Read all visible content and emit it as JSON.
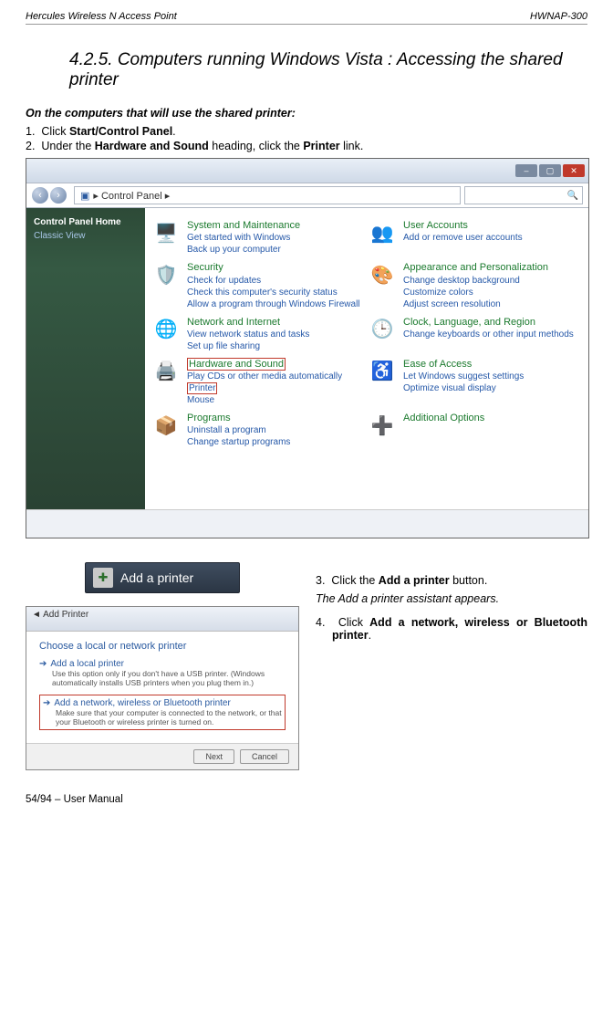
{
  "header": {
    "left": "Hercules Wireless N Access Point",
    "right": "HWNAP-300"
  },
  "section_title": "4.2.5.  Computers running Windows Vista : Accessing the shared printer",
  "intro": "On the computers that will use the shared printer:",
  "step1_num": "1.",
  "step1_a": "Click ",
  "step1_b": "Start/Control Panel",
  "step1_c": ".",
  "step2_num": "2.",
  "step2_a": "Under the ",
  "step2_b": "Hardware and Sound",
  "step2_c": " heading, click the ",
  "step2_d": "Printer",
  "step2_e": " link.",
  "cp": {
    "breadcrumb": "▸  Control Panel  ▸",
    "side_home": "Control Panel Home",
    "side_classic": "Classic View",
    "items": [
      {
        "icon": "🖥️",
        "title": "System and Maintenance",
        "links": [
          "Get started with Windows",
          "Back up your computer"
        ]
      },
      {
        "icon": "👥",
        "title": "User Accounts",
        "links": [
          "Add or remove user accounts"
        ]
      },
      {
        "icon": "🛡️",
        "title": "Security",
        "links": [
          "Check for updates",
          "Check this computer's security status",
          "Allow a program through Windows Firewall"
        ]
      },
      {
        "icon": "🎨",
        "title": "Appearance and Personalization",
        "links": [
          "Change desktop background",
          "Customize colors",
          "Adjust screen resolution"
        ]
      },
      {
        "icon": "🌐",
        "title": "Network and Internet",
        "links": [
          "View network status and tasks",
          "Set up file sharing"
        ]
      },
      {
        "icon": "🕒",
        "title": "Clock, Language, and Region",
        "links": [
          "Change keyboards or other input methods"
        ]
      },
      {
        "icon": "🖨️",
        "title": "Hardware and Sound",
        "links": [
          "Play CDs or other media automatically",
          "Printer",
          "Mouse"
        ],
        "hl_title": true,
        "hl_link_index": 1
      },
      {
        "icon": "♿",
        "title": "Ease of Access",
        "links": [
          "Let Windows suggest settings",
          "Optimize visual display"
        ]
      },
      {
        "icon": "📦",
        "title": "Programs",
        "links": [
          "Uninstall a program",
          "Change startup programs"
        ]
      },
      {
        "icon": "➕",
        "title": "Additional Options",
        "links": []
      }
    ]
  },
  "addprinter_label": "Add a printer",
  "wizard": {
    "title": "Add Printer",
    "question": "Choose a local or network printer",
    "opt1_t": "Add a local printer",
    "opt1_d": "Use this option only if you don't have a USB printer. (Windows automatically installs USB printers when you plug them in.)",
    "opt2_t": "Add a network, wireless or Bluetooth printer",
    "opt2_d": "Make sure that your computer is connected to the network, or that your Bluetooth or wireless printer is turned on.",
    "next": "Next",
    "cancel": "Cancel"
  },
  "right": {
    "s3_num": "3.",
    "s3_a": "Click the ",
    "s3_b": "Add a printer",
    "s3_c": " button.",
    "ital": "The Add a printer assistant appears.",
    "s4_num": "4.",
    "s4_a": "Click ",
    "s4_b": "Add a network, wireless or Bluetooth printer",
    "s4_c": "."
  },
  "footer": "54/94 – User Manual"
}
